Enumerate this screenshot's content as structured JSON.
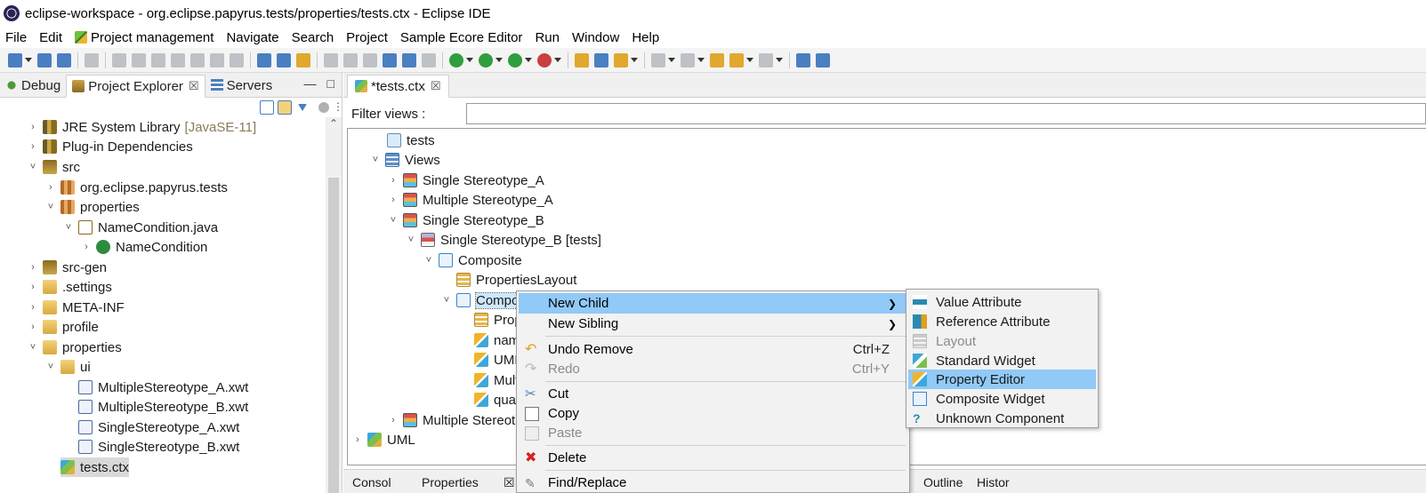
{
  "window": {
    "title": "eclipse-workspace - org.eclipse.papyrus.tests/properties/tests.ctx - Eclipse IDE"
  },
  "menubar": [
    "File",
    "Edit",
    "Project management",
    "Navigate",
    "Search",
    "Project",
    "Sample Ecore Editor",
    "Run",
    "Window",
    "Help"
  ],
  "left_panel": {
    "tabs": [
      {
        "label": "Debug",
        "icon": "debug-icon"
      },
      {
        "label": "Project Explorer",
        "icon": "project-explorer-icon",
        "close": "☒"
      },
      {
        "label": "Servers",
        "icon": "servers-icon"
      }
    ],
    "tree": [
      {
        "label": "JRE System Library",
        "suffix": "[JavaSE-11]",
        "icon": "library-icon",
        "expanded": false
      },
      {
        "label": "Plug-in Dependencies",
        "icon": "library-icon",
        "expanded": false
      },
      {
        "label": "src",
        "icon": "source-folder-icon",
        "expanded": true
      },
      {
        "label": "org.eclipse.papyrus.tests",
        "icon": "package-icon",
        "expanded": false
      },
      {
        "label": "properties",
        "icon": "package-icon",
        "expanded": true
      },
      {
        "label": "NameCondition.java",
        "icon": "java-file-icon",
        "expanded": true
      },
      {
        "label": "NameCondition",
        "icon": "class-icon",
        "expanded": false
      },
      {
        "label": "src-gen",
        "icon": "source-folder-icon",
        "expanded": false
      },
      {
        "label": ".settings",
        "icon": "folder-icon",
        "expanded": false
      },
      {
        "label": "META-INF",
        "icon": "folder-icon",
        "expanded": false
      },
      {
        "label": "profile",
        "icon": "folder-icon",
        "expanded": false
      },
      {
        "label": "properties",
        "icon": "folder-icon",
        "expanded": true
      },
      {
        "label": "ui",
        "icon": "folder-icon",
        "expanded": true
      },
      {
        "label": "MultipleStereotype_A.xwt",
        "icon": "xwt-file-icon"
      },
      {
        "label": "MultipleStereotype_B.xwt",
        "icon": "xwt-file-icon"
      },
      {
        "label": "SingleStereotype_A.xwt",
        "icon": "xwt-file-icon"
      },
      {
        "label": "SingleStereotype_B.xwt",
        "icon": "xwt-file-icon"
      },
      {
        "label": "tests.ctx",
        "icon": "context-file-icon",
        "selected": true
      }
    ]
  },
  "editor": {
    "tab_label": "*tests.ctx",
    "tab_close": "☒",
    "filter_label": "Filter views :",
    "filter_value": "",
    "tree": [
      {
        "label": "tests",
        "icon": "model-icon"
      },
      {
        "label": "Views",
        "icon": "views-icon",
        "expanded": true
      },
      {
        "label": "Single Stereotype_A",
        "icon": "view-icon",
        "expanded": false
      },
      {
        "label": "Multiple Stereotype_A",
        "icon": "view-icon",
        "expanded": false
      },
      {
        "label": "Single Stereotype_B",
        "icon": "view-icon",
        "expanded": true
      },
      {
        "label": "Single Stereotype_B [tests]",
        "icon": "view-page-icon",
        "expanded": true
      },
      {
        "label": "Composite",
        "icon": "composite-icon",
        "expanded": true
      },
      {
        "label": "PropertiesLayout",
        "icon": "layout-icon"
      },
      {
        "label": "Compo",
        "icon": "composite-icon",
        "expanded": true,
        "selected": true
      },
      {
        "label": "Prop",
        "icon": "layout-icon"
      },
      {
        "label": "nam",
        "icon": "property-editor-icon"
      },
      {
        "label": "UML",
        "icon": "property-editor-icon"
      },
      {
        "label": "Mult",
        "icon": "property-editor-icon"
      },
      {
        "label": "qual",
        "icon": "property-editor-icon"
      },
      {
        "label": "Multiple Stereot",
        "icon": "view-icon",
        "expanded": false
      },
      {
        "label": "UML",
        "icon": "uml-icon",
        "expanded": false
      }
    ],
    "bottom_tabs": [
      "Consol",
      "Properties",
      "☒",
      "Outline",
      "Histor"
    ]
  },
  "context_menu": {
    "items": [
      {
        "label": "New Child",
        "submenu": true,
        "highlighted": true
      },
      {
        "label": "New Sibling",
        "submenu": true
      },
      {
        "label": "Undo Remove",
        "shortcut": "Ctrl+Z",
        "icon": "undo-icon"
      },
      {
        "label": "Redo",
        "shortcut": "Ctrl+Y",
        "icon": "redo-icon",
        "disabled": true
      },
      {
        "label": "Cut",
        "icon": "cut-icon"
      },
      {
        "label": "Copy",
        "icon": "copy-icon"
      },
      {
        "label": "Paste",
        "icon": "paste-icon",
        "disabled": true
      },
      {
        "label": "Delete",
        "icon": "delete-icon"
      },
      {
        "label": "Find/Replace",
        "icon": "find-replace-icon"
      }
    ]
  },
  "submenu": {
    "items": [
      {
        "label": "Value Attribute",
        "icon": "value-attribute-icon"
      },
      {
        "label": "Reference Attribute",
        "icon": "reference-attribute-icon"
      },
      {
        "label": "Layout",
        "icon": "layout-icon",
        "disabled": true
      },
      {
        "label": "Standard Widget",
        "icon": "standard-widget-icon"
      },
      {
        "label": "Property Editor",
        "icon": "property-editor-icon",
        "highlighted": true
      },
      {
        "label": "Composite Widget",
        "icon": "composite-widget-icon"
      },
      {
        "label": "Unknown Component",
        "icon": "unknown-component-icon"
      }
    ]
  },
  "colors": {
    "selection": "#91c9f7",
    "menu_bg": "#f2f2f2",
    "accent": "#2c2255"
  }
}
